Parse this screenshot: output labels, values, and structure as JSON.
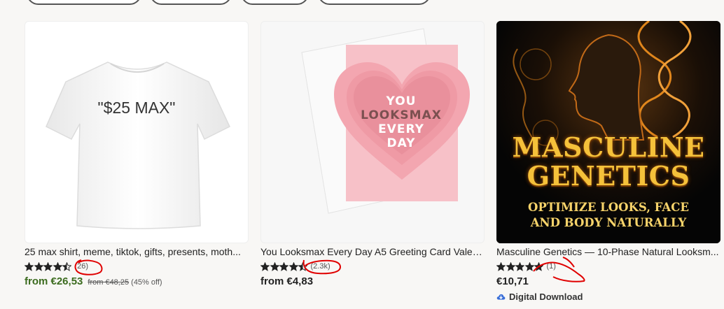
{
  "colors": {
    "accent_sale": "#3b6b1e",
    "annotation": "#e00000",
    "digital_icon": "#3a6fd8"
  },
  "products": [
    {
      "image_text": "\"$25 MAX\"",
      "title": "25 max shirt, meme, tiktok, gifts, presents, moth...",
      "rating": 4.5,
      "review_count": "(26)",
      "price": "from €26,53",
      "original_price": "from €48,25",
      "discount": "(45% off)"
    },
    {
      "image_text": [
        "YOU",
        "LOOKSMAX",
        "EVERY",
        "DAY"
      ],
      "title": "You Looksmax Every Day A5 Greeting Card Valen...",
      "rating": 4.5,
      "review_count": "(2.3k)",
      "price": "from €4,83"
    },
    {
      "image_title": [
        "MASCULINE",
        "GENETICS"
      ],
      "image_subtitle": [
        "OPTIMIZE LOOKS, FACE",
        "AND BODY NATURALLY"
      ],
      "title": "Masculine Genetics — 10-Phase Natural Looksm...",
      "rating": 5,
      "review_count": "(1)",
      "price": "€10,71",
      "badge": "Digital Download",
      "badge_icon": "cloud-download-icon"
    }
  ]
}
